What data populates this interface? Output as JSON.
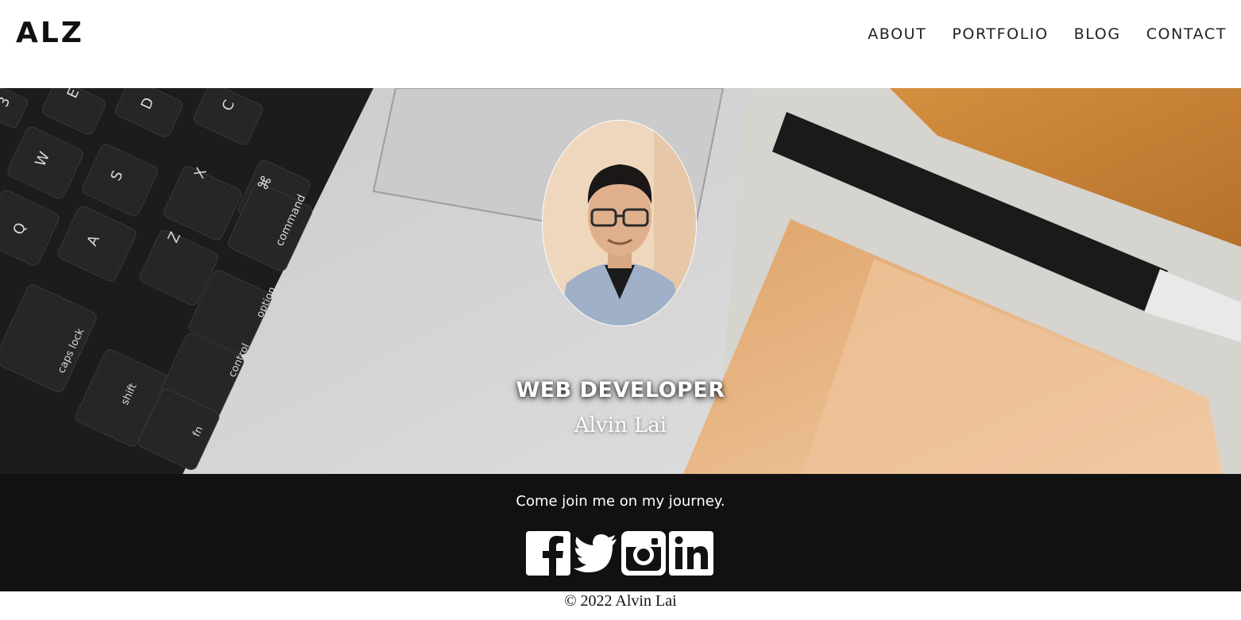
{
  "header": {
    "logo": "ALZ",
    "nav": [
      "ABOUT",
      "PORTFOLIO",
      "BLOG",
      "CONTACT"
    ]
  },
  "hero": {
    "role": "WEB DEVELOPER",
    "name": "Alvin Lai",
    "keys": [
      {
        "label": "3"
      },
      {
        "label": "E"
      },
      {
        "label": "D"
      },
      {
        "label": "C"
      },
      {
        "label": "W"
      },
      {
        "label": "S"
      },
      {
        "label": "X"
      },
      {
        "label": "⌘"
      },
      {
        "label": "Q"
      },
      {
        "label": "A"
      },
      {
        "label": "Z"
      },
      {
        "label": "command"
      },
      {
        "label": "caps lock"
      },
      {
        "label": "shift"
      },
      {
        "label": "option"
      },
      {
        "label": "control"
      },
      {
        "label": "fn"
      }
    ]
  },
  "footer": {
    "tagline": "Come join me on my journey.",
    "socials": [
      {
        "icon": "facebook-icon",
        "label": "f"
      },
      {
        "icon": "twitter-icon",
        "label": ""
      },
      {
        "icon": "instagram-icon",
        "label": ""
      },
      {
        "icon": "linkedin-icon",
        "label": "in"
      }
    ],
    "copyright": "© 2022 Alvin Lai"
  },
  "colors": {
    "header_bg": "#ffffff",
    "footer_bg": "#111111",
    "text_dark": "#111111",
    "text_light": "#ffffff"
  }
}
